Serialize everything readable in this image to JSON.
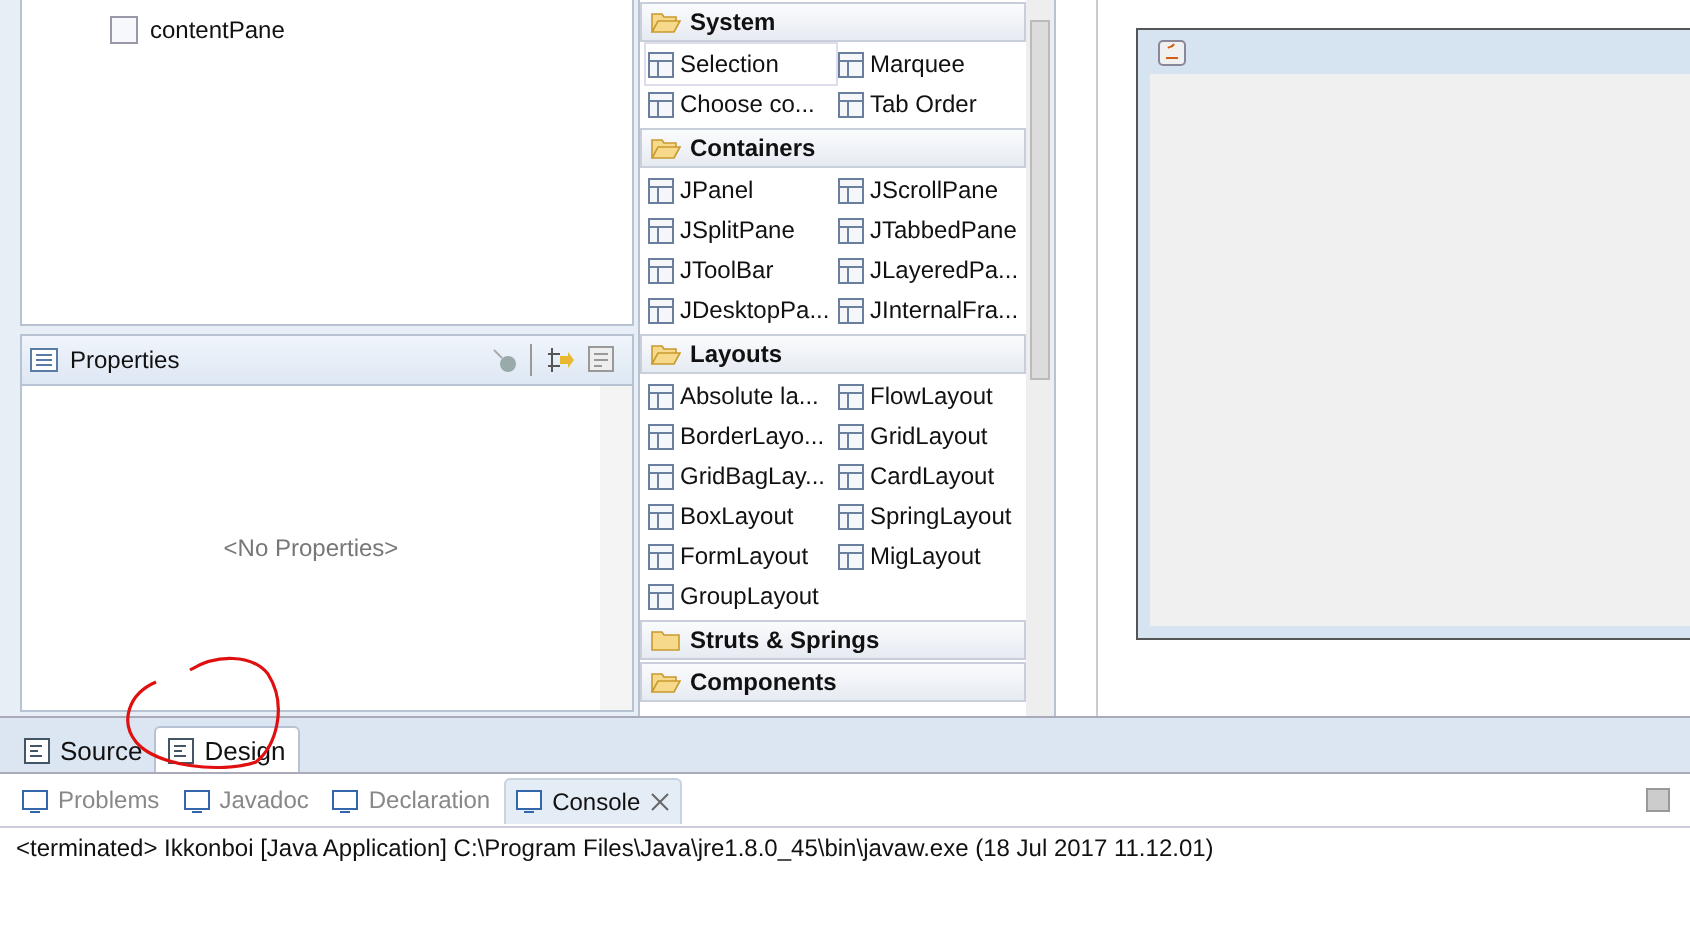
{
  "outline": {
    "items": [
      {
        "label": "contentPane",
        "selected": false
      }
    ]
  },
  "properties": {
    "title": "Properties",
    "empty_text": "<No Properties>"
  },
  "palette": {
    "categories": [
      {
        "label": "System",
        "expanded": true,
        "items": [
          {
            "label": "Selection",
            "selected": true
          },
          {
            "label": "Marquee",
            "selected": false
          },
          {
            "label": "Choose co...",
            "selected": false
          },
          {
            "label": "Tab Order",
            "selected": false
          }
        ]
      },
      {
        "label": "Containers",
        "expanded": true,
        "items": [
          {
            "label": "JPanel",
            "selected": false
          },
          {
            "label": "JScrollPane",
            "selected": false
          },
          {
            "label": "JSplitPane",
            "selected": false
          },
          {
            "label": "JTabbedPane",
            "selected": false
          },
          {
            "label": "JToolBar",
            "selected": false
          },
          {
            "label": "JLayeredPa...",
            "selected": false
          },
          {
            "label": "JDesktopPa...",
            "selected": false
          },
          {
            "label": "JInternalFra...",
            "selected": false
          }
        ]
      },
      {
        "label": "Layouts",
        "expanded": true,
        "items": [
          {
            "label": "Absolute la...",
            "selected": false
          },
          {
            "label": "FlowLayout",
            "selected": false
          },
          {
            "label": "BorderLayo...",
            "selected": false
          },
          {
            "label": "GridLayout",
            "selected": false
          },
          {
            "label": "GridBagLay...",
            "selected": false
          },
          {
            "label": "CardLayout",
            "selected": false
          },
          {
            "label": "BoxLayout",
            "selected": false
          },
          {
            "label": "SpringLayout",
            "selected": false
          },
          {
            "label": "FormLayout",
            "selected": false
          },
          {
            "label": "MigLayout",
            "selected": false
          },
          {
            "label": "GroupLayout",
            "selected": false
          }
        ]
      },
      {
        "label": "Struts & Springs",
        "expanded": false
      },
      {
        "label": "Components",
        "expanded": true
      }
    ]
  },
  "editor_tabs": [
    {
      "label": "Source",
      "selected": false
    },
    {
      "label": "Design",
      "selected": true
    }
  ],
  "console": {
    "tabs": [
      {
        "label": "Problems",
        "selected": false
      },
      {
        "label": "Javadoc",
        "selected": false
      },
      {
        "label": "Declaration",
        "selected": false
      },
      {
        "label": "Console",
        "selected": true
      }
    ],
    "output": "<terminated> Ikkonboi [Java Application] C:\\Program Files\\Java\\jre1.8.0_45\\bin\\javaw.exe (18 Jul 2017 11.12.01)"
  }
}
